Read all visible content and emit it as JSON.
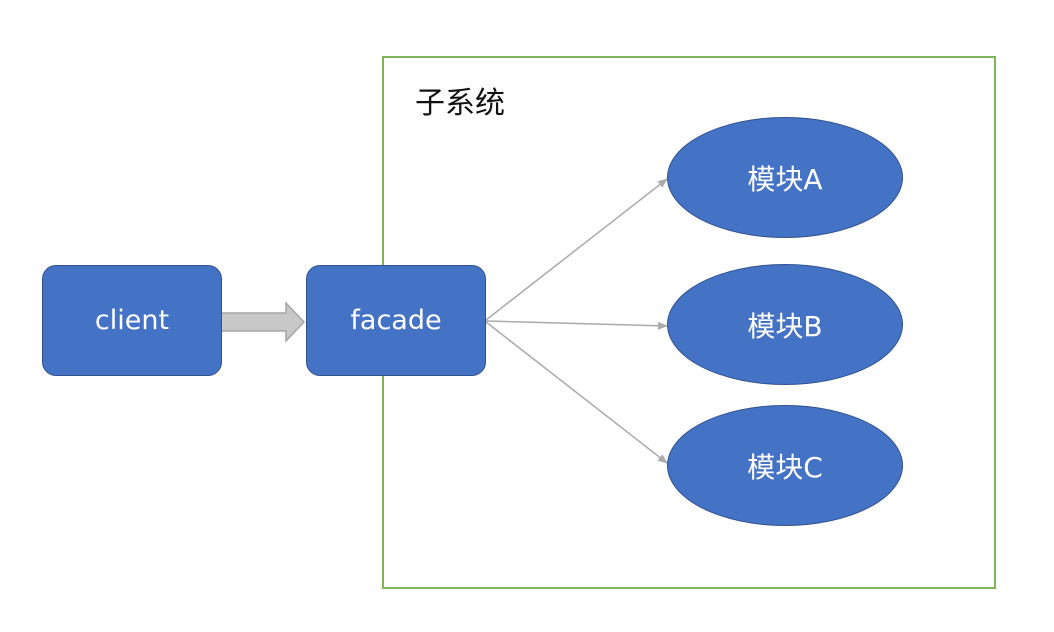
{
  "subsystem": {
    "title": "子系统"
  },
  "nodes": {
    "client": "client",
    "facade": "facade",
    "modules": [
      "模块A",
      "模块B",
      "模块C"
    ]
  },
  "colors": {
    "node_fill": "#4472c4",
    "node_border": "#2f528f",
    "frame_border": "#7fb45a",
    "connector": "#aaaaaa",
    "block_arrow": "#c0c0c0"
  }
}
